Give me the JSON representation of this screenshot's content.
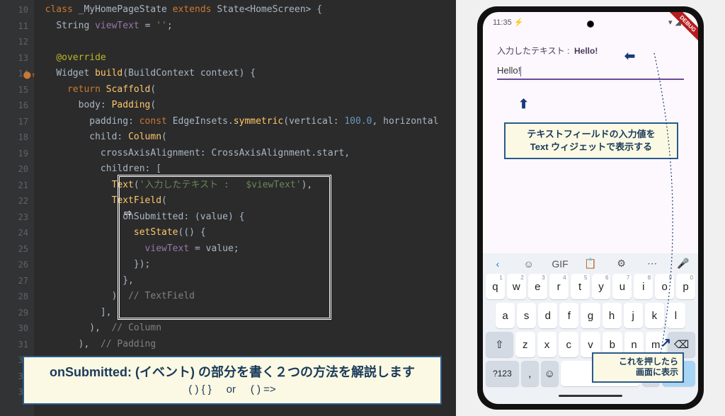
{
  "editor": {
    "lines_start": 10,
    "lines_end": 34,
    "code": {
      "l10": {
        "indent": 1,
        "tokens": [
          {
            "t": "class ",
            "c": "kw"
          },
          {
            "t": "_MyHomePageState ",
            "c": "cls"
          },
          {
            "t": "extends ",
            "c": "kw"
          },
          {
            "t": "State<HomeScreen> {",
            "c": "type"
          }
        ]
      },
      "l11": {
        "indent": 2,
        "tokens": [
          {
            "t": "String ",
            "c": "type"
          },
          {
            "t": "viewText ",
            "c": "fld"
          },
          {
            "t": "= ",
            "c": ""
          },
          {
            "t": "''",
            "c": "str"
          },
          {
            "t": ";",
            "c": ""
          }
        ]
      },
      "l12": {
        "indent": 0,
        "tokens": []
      },
      "l13": {
        "indent": 2,
        "tokens": [
          {
            "t": "@override",
            "c": "ann"
          }
        ]
      },
      "l14": {
        "indent": 2,
        "tokens": [
          {
            "t": "Widget ",
            "c": "type"
          },
          {
            "t": "build",
            "c": "fn"
          },
          {
            "t": "(BuildContext context) {",
            "c": ""
          }
        ]
      },
      "l15": {
        "indent": 3,
        "tokens": [
          {
            "t": "return ",
            "c": "kw"
          },
          {
            "t": "Scaffold",
            "c": "fn"
          },
          {
            "t": "(",
            "c": ""
          }
        ]
      },
      "l16": {
        "indent": 4,
        "tokens": [
          {
            "t": "body: ",
            "c": "prm"
          },
          {
            "t": "Padding",
            "c": "fn"
          },
          {
            "t": "(",
            "c": ""
          }
        ]
      },
      "l17": {
        "indent": 5,
        "tokens": [
          {
            "t": "padding: ",
            "c": "prm"
          },
          {
            "t": "const ",
            "c": "kw"
          },
          {
            "t": "EdgeInsets.",
            "c": "type"
          },
          {
            "t": "symmetric",
            "c": "fn"
          },
          {
            "t": "(vertical: ",
            "c": ""
          },
          {
            "t": "100.0",
            "c": "num"
          },
          {
            "t": ", horizontal",
            "c": ""
          }
        ]
      },
      "l18": {
        "indent": 5,
        "tokens": [
          {
            "t": "child: ",
            "c": "prm"
          },
          {
            "t": "Column",
            "c": "fn"
          },
          {
            "t": "(",
            "c": ""
          }
        ]
      },
      "l19": {
        "indent": 6,
        "tokens": [
          {
            "t": "crossAxisAlignment: CrossAxisAlignment.start,",
            "c": ""
          }
        ]
      },
      "l20": {
        "indent": 6,
        "tokens": [
          {
            "t": "children: [",
            "c": ""
          }
        ]
      },
      "l21": {
        "indent": 7,
        "tokens": [
          {
            "t": "Text",
            "c": "fn"
          },
          {
            "t": "(",
            "c": ""
          },
          {
            "t": "'入力したテキスト :   $viewText'",
            "c": "str"
          },
          {
            "t": "),",
            "c": ""
          }
        ]
      },
      "l22": {
        "indent": 7,
        "tokens": [
          {
            "t": "TextField",
            "c": "fn"
          },
          {
            "t": "(",
            "c": ""
          }
        ]
      },
      "l23": {
        "indent": 8,
        "tokens": [
          {
            "t": "onSubmitted: (value) {",
            "c": ""
          }
        ]
      },
      "l24": {
        "indent": 9,
        "tokens": [
          {
            "t": "setState",
            "c": "fn"
          },
          {
            "t": "(() {",
            "c": ""
          }
        ]
      },
      "l25": {
        "indent": 10,
        "tokens": [
          {
            "t": "viewText ",
            "c": "fld"
          },
          {
            "t": "= value;",
            "c": ""
          }
        ]
      },
      "l26": {
        "indent": 9,
        "tokens": [
          {
            "t": "});",
            "c": ""
          }
        ]
      },
      "l27": {
        "indent": 8,
        "tokens": [
          {
            "t": "},",
            "c": ""
          }
        ]
      },
      "l28": {
        "indent": 7,
        "tokens": [
          {
            "t": ")  ",
            "c": ""
          },
          {
            "t": "// TextField",
            "c": "cmt"
          }
        ]
      },
      "l29": {
        "indent": 6,
        "tokens": [
          {
            "t": "],",
            "c": ""
          }
        ]
      },
      "l30": {
        "indent": 5,
        "tokens": [
          {
            "t": "),  ",
            "c": ""
          },
          {
            "t": "// Column",
            "c": "cmt"
          }
        ]
      },
      "l31": {
        "indent": 4,
        "tokens": [
          {
            "t": "),  ",
            "c": ""
          },
          {
            "t": "// Padding",
            "c": "cmt"
          }
        ]
      },
      "l32": {
        "indent": 0,
        "tokens": []
      },
      "l33": {
        "indent": 0,
        "tokens": []
      },
      "l34": {
        "indent": 2,
        "tokens": [
          {
            "t": "}",
            "c": ""
          }
        ]
      }
    },
    "gutter_mark_line": 14
  },
  "explain": {
    "title": "onSubmitted: (イベント) の部分を書く２つの方法を解説します",
    "sub_a": "( ) { }",
    "sub_or": "or",
    "sub_b": "( ) =>"
  },
  "phone": {
    "time": "11:35",
    "debug": "DEBUG",
    "display_label": "入力したテキスト :",
    "display_value": "Hello!",
    "field_value": "Hello!",
    "note1_l1": "テキストフィールドの入力値を",
    "note1_l2": "Text ウィジェットで表示する",
    "note2_l1": "これを押したら",
    "note2_l2": "画面に表示",
    "kb": {
      "suggest": [
        "‹",
        "☺",
        "GIF",
        "📋",
        "⚙",
        "⋯",
        "🎤"
      ],
      "row1": [
        [
          "q",
          "1"
        ],
        [
          "w",
          "2"
        ],
        [
          "e",
          "3"
        ],
        [
          "r",
          "4"
        ],
        [
          "t",
          "5"
        ],
        [
          "y",
          "6"
        ],
        [
          "u",
          "7"
        ],
        [
          "i",
          "8"
        ],
        [
          "o",
          "9"
        ],
        [
          "p",
          "0"
        ]
      ],
      "row2": [
        "a",
        "s",
        "d",
        "f",
        "g",
        "h",
        "j",
        "k",
        "l"
      ],
      "row3_shift": "⇧",
      "row3": [
        "z",
        "x",
        "c",
        "v",
        "b",
        "n",
        "m"
      ],
      "row3_del": "⌫",
      "row4": {
        "sym": "?123",
        "comma": ",",
        "emoji": "☺",
        "space": "",
        "dot": ".",
        "enter": "✓"
      }
    }
  }
}
